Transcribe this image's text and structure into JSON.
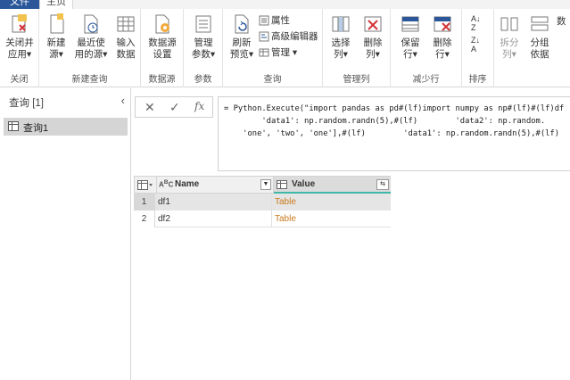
{
  "tabs": {
    "file": "文件",
    "home": "主页"
  },
  "ribbon": {
    "close": {
      "btn": "关闭并\n应用▾",
      "group": "关闭"
    },
    "newquery": {
      "new": "新建\n源▾",
      "recent": "最近使\n用的源▾",
      "input": "输入\n数据",
      "group": "新建查询"
    },
    "datasource": {
      "settings": "数据源\n设置",
      "group": "数据源"
    },
    "params": {
      "manage": "管理\n参数▾",
      "group": "参数"
    },
    "query": {
      "refresh": "刷新\n预览▾",
      "properties": "属性",
      "advanced": "高级编辑器",
      "manage": "管理 ▾",
      "group": "查询"
    },
    "columns": {
      "choose": "选择\n列▾",
      "remove": "删除\n列▾",
      "group": "管理列"
    },
    "rows": {
      "keep": "保留\n行▾",
      "remove": "删除\n行▾",
      "group": "减少行"
    },
    "sort": {
      "group": "排序"
    },
    "transform": {
      "split": "拆分\n列▾",
      "groupby": "分组\n依据",
      "data_type_label": "数"
    }
  },
  "query_pane": {
    "header": "查询 [1]",
    "item": "查询1"
  },
  "formula": {
    "lines": [
      "= Python.Execute(\"import pandas as pd#(lf)import numpy as np#(lf)#(lf)df",
      "        'data1': np.random.randn(5),#(lf)        'data2': np.random.",
      "    'one', 'two', 'one'],#(lf)        'data1': np.random.randn(5),#(lf)"
    ]
  },
  "grid": {
    "columns": [
      "Name",
      "Value"
    ],
    "rows": [
      {
        "n": "1",
        "name": "df1",
        "value": "Table"
      },
      {
        "n": "2",
        "name": "df2",
        "value": "Table"
      }
    ]
  },
  "colors": {
    "accent": "#2b579a",
    "table_link": "#c97a1e",
    "value_header_bar": "#3fb8a8"
  }
}
